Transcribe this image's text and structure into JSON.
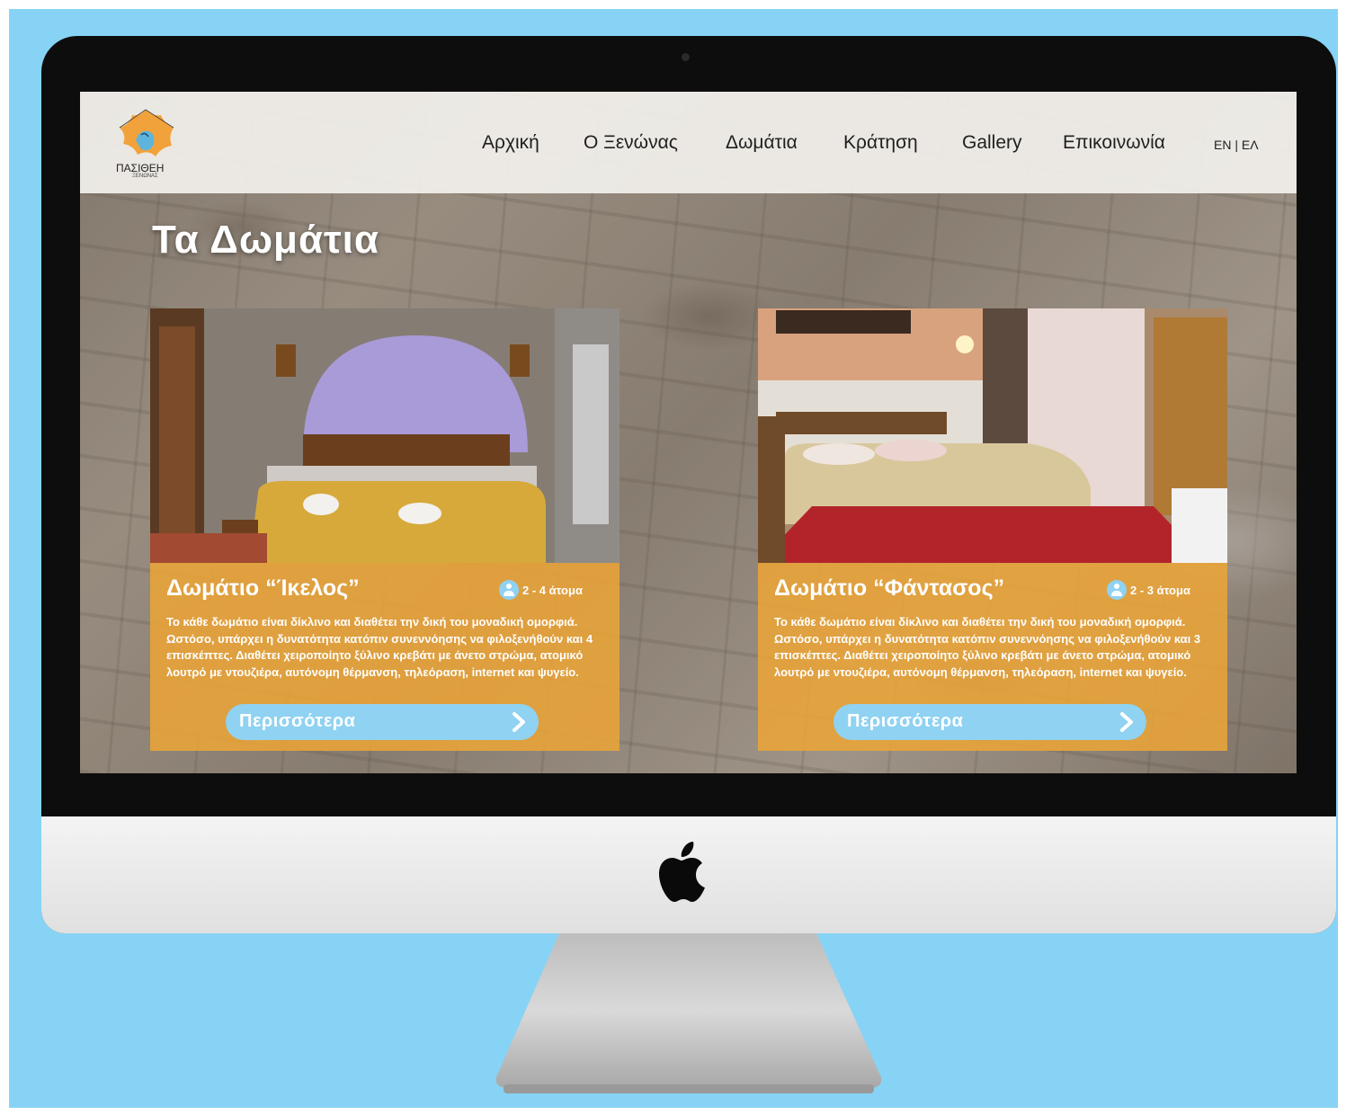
{
  "site": {
    "logo_text": "ΠΑΣΙΘΕΗ",
    "logo_subtext": "ΞΕΝΩΝΑΣ",
    "nav": [
      "Αρχική",
      "Ο Ξενώνας",
      "Δωμάτια",
      "Κράτηση",
      "Gallery",
      "Επικοινωνία"
    ],
    "lang_switch": "EN | EΛ",
    "page_title": "Τα Δωμάτια"
  },
  "rooms": [
    {
      "title": "Δωμάτιο “Ίκελος”",
      "capacity": "2 - 4 άτομα",
      "description": "Το κάθε δωμάτιο είναι δίκλινο και διαθέτει την δική του μοναδική ομορφιά. Ωστόσο, υπάρχει η δυνατότητα κατόπιν συνεννόησης να φιλοξενήθούν και 4 επισκέπτες. Διαθέτει χειροποίητο ξύλινο κρεβάτι με άνετο στρώμα, ατομικό λουτρό με ντουζιέρα, αυτόνομη θέρμανση, τηλεόραση, internet και ψυγείο.",
      "button": "Περισσότερα"
    },
    {
      "title": "Δωμάτιο “Φάντασος”",
      "capacity": "2 - 3 άτομα",
      "description": "Το κάθε δωμάτιο είναι δίκλινο και διαθέτει την δική του μοναδική ομορφιά. Ωστόσο, υπάρχει η δυνατότητα κατόπιν συνεννόησης να φιλοξενήθούν και 3 επισκέπτες. Διαθέτει χειροποίητο ξύλινο κρεβάτι με άνετο στρώμα, ατομικό λουτρό με ντουζιέρα, αυτόνομη θέρμανση, τηλεόραση, internet και ψυγείο.",
      "button": "Περισσότερα"
    }
  ],
  "colors": {
    "background": "#87d3f5",
    "card_panel": "#eaa438",
    "button": "#8fd2f2",
    "header": "#f2f0ec"
  },
  "icons": [
    "apple-logo-icon",
    "user-icon",
    "chevron-right-icon",
    "flower-logo-icon"
  ]
}
